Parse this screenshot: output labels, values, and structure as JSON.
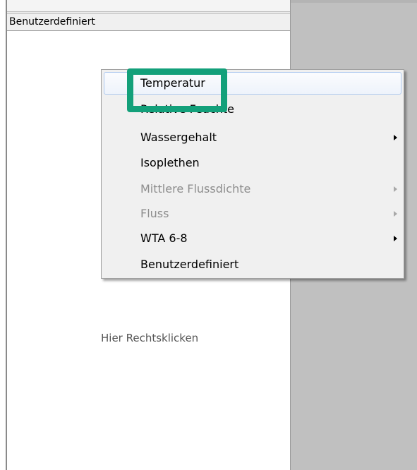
{
  "panel": {
    "header_label": "Benutzerdefiniert",
    "hint_text": "Hier Rechtsklicken"
  },
  "context_menu": {
    "items": [
      {
        "label": "Temperatur",
        "enabled": true,
        "has_submenu": false,
        "hovered": true
      },
      {
        "label": "Relative Feuchte",
        "enabled": true,
        "has_submenu": false,
        "hovered": false
      },
      {
        "label": "Wassergehalt",
        "enabled": true,
        "has_submenu": true,
        "hovered": false
      },
      {
        "label": "Isoplethen",
        "enabled": true,
        "has_submenu": false,
        "hovered": false
      },
      {
        "label": "Mittlere Flussdichte",
        "enabled": false,
        "has_submenu": true,
        "hovered": false
      },
      {
        "label": "Fluss",
        "enabled": false,
        "has_submenu": true,
        "hovered": false
      },
      {
        "label": "WTA 6-8",
        "enabled": true,
        "has_submenu": true,
        "hovered": false
      },
      {
        "label": "Benutzerdefiniert",
        "enabled": true,
        "has_submenu": false,
        "hovered": false
      }
    ]
  },
  "highlight": {
    "color": "#13a07a",
    "target": "Temperatur"
  }
}
